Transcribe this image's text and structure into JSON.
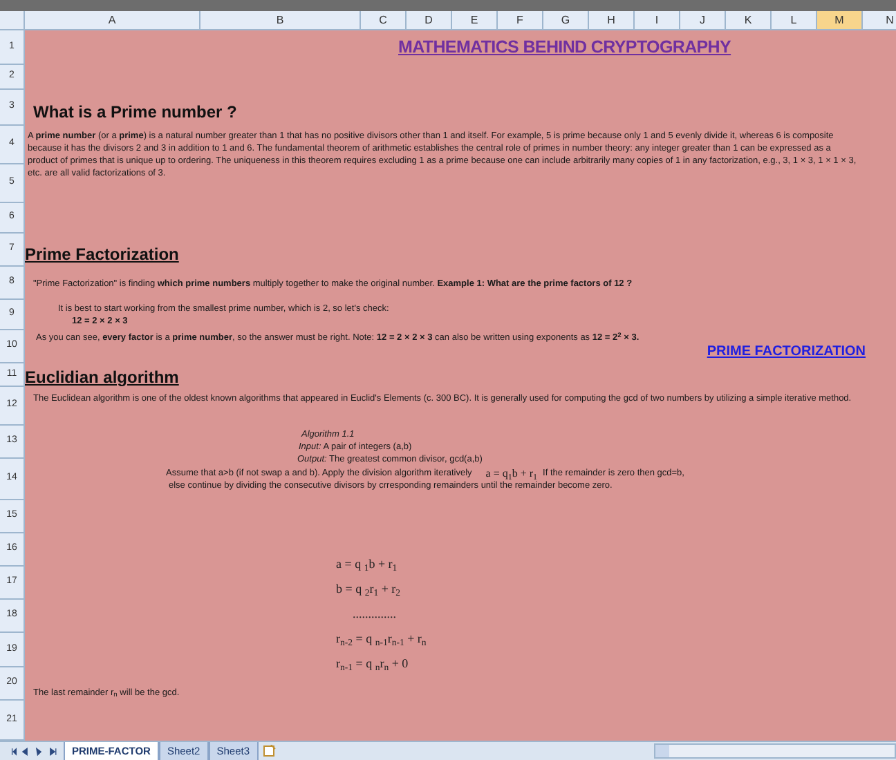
{
  "columns": [
    {
      "label": "A",
      "selected": false
    },
    {
      "label": "B",
      "selected": false
    },
    {
      "label": "C",
      "selected": false
    },
    {
      "label": "D",
      "selected": false
    },
    {
      "label": "E",
      "selected": false
    },
    {
      "label": "F",
      "selected": false
    },
    {
      "label": "G",
      "selected": false
    },
    {
      "label": "H",
      "selected": false
    },
    {
      "label": "I",
      "selected": false
    },
    {
      "label": "J",
      "selected": false
    },
    {
      "label": "K",
      "selected": false
    },
    {
      "label": "L",
      "selected": false
    },
    {
      "label": "M",
      "selected": true
    },
    {
      "label": "N",
      "selected": false
    }
  ],
  "row_numbers": [
    "1",
    "2",
    "3",
    "4",
    "5",
    "6",
    "7",
    "8",
    "9",
    "10",
    "11",
    "12",
    "13",
    "14",
    "15",
    "16",
    "17",
    "18",
    "19",
    "20",
    "21"
  ],
  "title": "MATHEMATICS BEHIND CRYPTOGRAPHY",
  "prime_section": {
    "heading": "What is a Prime number ?",
    "paragraph": "A **prime number** (or a **prime**) is a natural number greater than 1 that has no positive divisors other than 1 and itself.   For example, 5 is prime because only 1 and 5 evenly divide it, whereas 6 is composite because it has the divisors 2 and 3 in addition to 1 and 6. The fundamental theorem of arithmetic establishes the central role of primes in number theory: any integer greater than 1 can be expressed as a product of primes that is unique up to ordering. The uniqueness in this theorem requires excluding 1 as a prime because one can include arbitrarily many copies of 1 in any factorization, e.g., 3, 1 × 3, 1 × 1 × 3, etc. are all valid factorizations of 3."
  },
  "factorization_section": {
    "heading": "Prime Factorization",
    "intro": "\"Prime Factorization\" is finding **which prime numbers** multiply together to make the original number. **Example 1: What are the prime factors of 12 ?**",
    "hint": "It is best to start working from the smallest prime number, which is 2, so let's check:",
    "example": "12 = 2 × 2 × 3",
    "conclusion": "As you can see, **every factor** is a **prime number**, so the answer must be right. Note: **12 = 2 × 2 × 3** can also be written using exponents as **12 = 2$^{2}$ × 3.**",
    "link": "PRIME FACTORIZATION"
  },
  "euclid_section": {
    "heading": "Euclidian algorithm",
    "paragraph": "The Euclidean algorithm is one of the oldest known algorithms that appeared in Euclid's Elements (c. 300 BC). It is generally used for computing the gcd of two numbers by utilizing a simple iterative method.",
    "algorithm_title": "Algorithm 1.1",
    "input": "*Input:* A pair of integers (a,b)",
    "output": "*Output:* The greatest common divisor, gcd(a,b)",
    "step": "Assume that a>b (if not swap a and b). Apply the division algorithm  iteratively",
    "step_formula": "a = q$_{1}$b + r$_{1}$",
    "step_end": "If the remainder is zero then gcd=b,",
    "step_cont": "else continue by dividing the  consecutive divisors by  crresponding remainders until the remainder become zero.",
    "formulas": [
      "a  =  q $_{1}$b  +  r$_{1}$",
      "b  =  q $_{2}$r$_{1}$  +  r$_{2}$",
      "..............",
      "r$_{n-2}$  =  q $_{n-1}$r$_{n-1}$  +  r$_{n}$",
      "r$_{n-1}$  =  q $_{n}$r$_{n}$  +  0"
    ],
    "last": "The last remainder     r$_{n}$     will be the gcd."
  },
  "sheet_tabs": [
    {
      "label": "PRIME-FACTOR",
      "selected": true
    },
    {
      "label": "Sheet2",
      "selected": false
    },
    {
      "label": "Sheet3",
      "selected": false
    }
  ]
}
